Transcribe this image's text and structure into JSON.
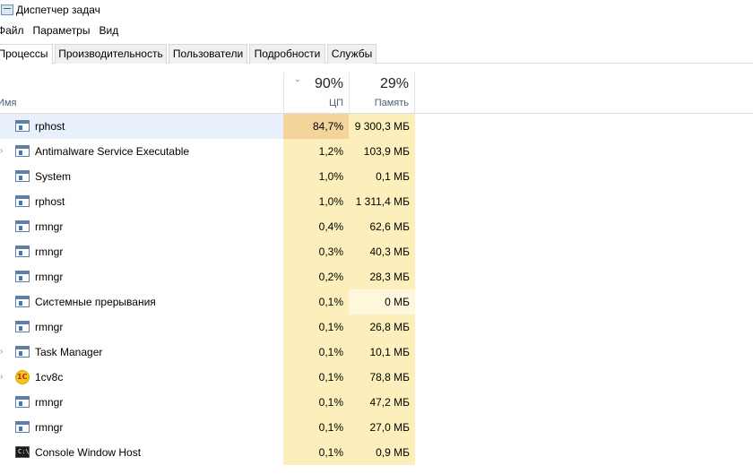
{
  "window": {
    "title": "Диспетчер задач"
  },
  "menu": [
    "Файл",
    "Параметры",
    "Вид"
  ],
  "tabs": [
    "Процессы",
    "Производительность",
    "Пользователи",
    "Подробности",
    "Службы"
  ],
  "active_tab": "Процессы",
  "columns": {
    "name": "Имя",
    "cpu": {
      "percent": "90%",
      "label": "ЦП"
    },
    "memory": {
      "percent": "29%",
      "label": "Память"
    }
  },
  "processes": [
    {
      "name": "rphost",
      "cpu": "84,7%",
      "memory": "9 300,3 МБ",
      "icon": "window-icon",
      "expandable": false,
      "selected": true
    },
    {
      "name": "Antimalware Service Executable",
      "cpu": "1,2%",
      "memory": "103,9 МБ",
      "icon": "window-icon",
      "expandable": true
    },
    {
      "name": "System",
      "cpu": "1,0%",
      "memory": "0,1 МБ",
      "icon": "window-icon",
      "expandable": false
    },
    {
      "name": "rphost",
      "cpu": "1,0%",
      "memory": "1 311,4 МБ",
      "icon": "window-icon",
      "expandable": false
    },
    {
      "name": "rmngr",
      "cpu": "0,4%",
      "memory": "62,6 МБ",
      "icon": "window-icon",
      "expandable": false
    },
    {
      "name": "rmngr",
      "cpu": "0,3%",
      "memory": "40,3 МБ",
      "icon": "window-icon",
      "expandable": false
    },
    {
      "name": "rmngr",
      "cpu": "0,2%",
      "memory": "28,3 МБ",
      "icon": "window-icon",
      "expandable": false
    },
    {
      "name": "Системные прерывания",
      "cpu": "0,1%",
      "memory": "0 МБ",
      "icon": "window-icon",
      "expandable": false
    },
    {
      "name": "rmngr",
      "cpu": "0,1%",
      "memory": "26,8 МБ",
      "icon": "window-icon",
      "expandable": false
    },
    {
      "name": "Task Manager",
      "cpu": "0,1%",
      "memory": "10,1 МБ",
      "icon": "window-icon",
      "expandable": true
    },
    {
      "name": "1cv8c",
      "cpu": "0,1%",
      "memory": "78,8 МБ",
      "icon": "1c-icon",
      "expandable": true
    },
    {
      "name": "rmngr",
      "cpu": "0,1%",
      "memory": "47,2 МБ",
      "icon": "window-icon",
      "expandable": false
    },
    {
      "name": "rmngr",
      "cpu": "0,1%",
      "memory": "27,0 МБ",
      "icon": "window-icon",
      "expandable": false
    },
    {
      "name": "Console Window Host",
      "cpu": "0,1%",
      "memory": "0,9 МБ",
      "icon": "console-icon",
      "expandable": false
    }
  ],
  "colors": {
    "cpu_high": "#f3d49b",
    "usage_fill": "#fcefbb",
    "usage_low": "#fff7dc",
    "selected_row": "#e8f1fb",
    "header_label": "#4c607a"
  }
}
